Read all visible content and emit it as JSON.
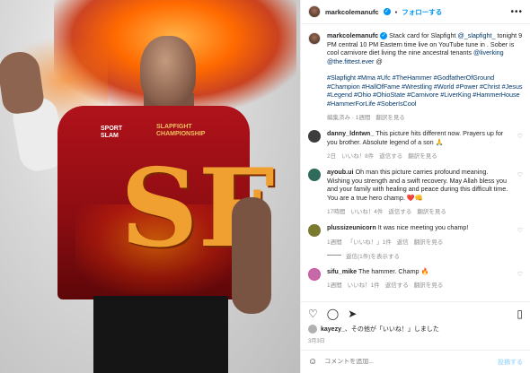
{
  "post": {
    "author": "markcolemanufc",
    "follow_label": "フォローする",
    "more": "•••"
  },
  "caption": {
    "username": "markcolemanufc",
    "text_1": "Stack card for Slapfight ",
    "mention_1": "@_slapfight_",
    "text_2": " tonight 9 PM central 10 PM Eastern time live on YouTube tune in . Sober is cool carnivore diet living the nine ancestral tenants ",
    "mention_2": "@liverking",
    "text_3": " ",
    "mention_3": "@the.fittest.ever",
    "text_4": " @",
    "hashtags": "#Slapfight #Mma #Ufc #TheHammer #GodfatherOfGround #Champion #HallOfFame #Wrestling #World #Power #Christ #Jesus #Legend #Ohio #OhioState #Carnivore #LiverKing #HammerHouse #HammerForLife #SoberIsCool",
    "meta_edited": "編集済み · 1週間",
    "meta_translate": "翻訳を見る"
  },
  "comments": [
    {
      "username": "danny_ldntwn_",
      "text": "This picture hits different now. Prayers up for you brother. Absolute legend of a son 🙏",
      "time": "2日",
      "likes": "いいね！8件",
      "reply": "返信する",
      "translate": "翻訳を見る"
    },
    {
      "username": "ayoub.ui",
      "text": "Oh man this picture carries profound meaning. Wishing you strength and a swift recovery. May Allah bless you and your family with healing and peace during this difficult time. You are a true hero champ. ❤️👊",
      "time": "17時間",
      "likes": "いいね！4件",
      "reply": "返信する",
      "translate": "翻訳を見る"
    },
    {
      "username": "plussizeunicorn",
      "text": "It was nice meeting you champ!",
      "time": "1週間",
      "likes": "「いいね！」1件",
      "reply": "返信",
      "translate": "翻訳を見る",
      "replies_label": "返信(1件)を表示する"
    },
    {
      "username": "sifu_mike",
      "text": "The hammer. Champ 🔥",
      "time": "1週間",
      "likes": "いいね！1件",
      "reply": "返信する",
      "translate": "翻訳を見る"
    }
  ],
  "actions": {
    "heart": "heart-icon",
    "comment": "comment-icon",
    "share": "share-icon",
    "save": "bookmark-icon"
  },
  "likes_line": {
    "user": "kayezy_",
    "suffix": "、その他が「いいね！」しました"
  },
  "date": "3月3日",
  "comment_box": {
    "placeholder": "コメントを追加...",
    "post_label": "投稿する",
    "emoji": "emoji-icon"
  },
  "shirt": {
    "sponsor": "SPORT SLAM",
    "brand": "SLAPFIGHT CHAMPIONSHIP",
    "logo": "SF"
  }
}
